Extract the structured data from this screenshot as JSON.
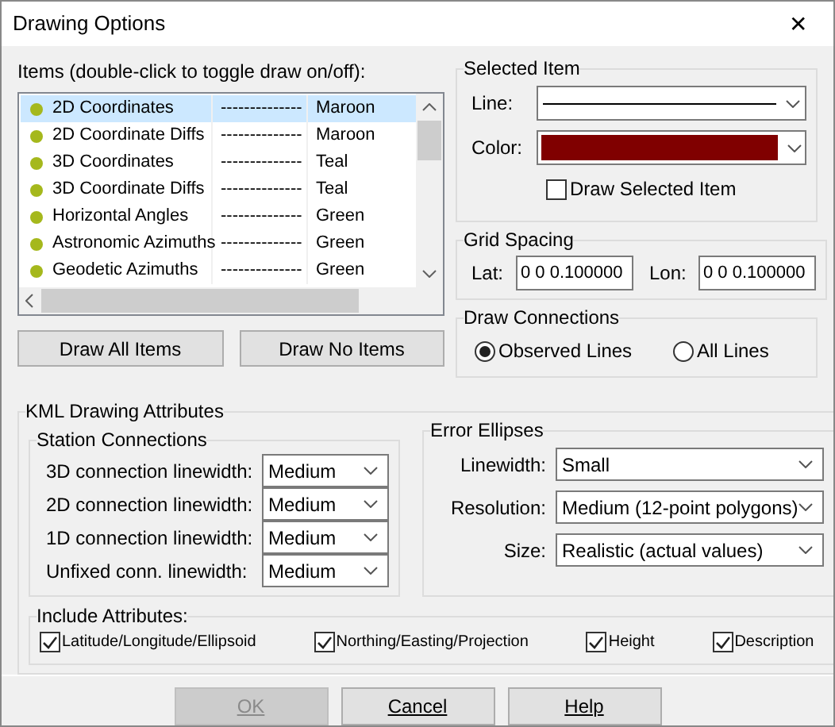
{
  "window": {
    "title": "Drawing Options",
    "close": "✕"
  },
  "items": {
    "label": "Items (double-click to toggle draw on/off):",
    "rows": [
      {
        "name": "2D Coordinates",
        "line": "--------------",
        "color_name": "Maroon",
        "selected": true,
        "color": "#a5b81c"
      },
      {
        "name": "2D Coordinate Diffs",
        "line": "--------------",
        "color_name": "Maroon",
        "selected": false,
        "color": "#a5b81c"
      },
      {
        "name": "3D Coordinates",
        "line": "--------------",
        "color_name": "Teal",
        "selected": false,
        "color": "#a5b81c"
      },
      {
        "name": "3D Coordinate Diffs",
        "line": "--------------",
        "color_name": "Teal",
        "selected": false,
        "color": "#a5b81c"
      },
      {
        "name": "Horizontal Angles",
        "line": "--------------",
        "color_name": "Green",
        "selected": false,
        "color": "#a5b81c"
      },
      {
        "name": "Astronomic Azimuths",
        "line": "--------------",
        "color_name": "Green",
        "selected": false,
        "color": "#a5b81c"
      },
      {
        "name": "Geodetic Azimuths",
        "line": "--------------",
        "color_name": "Green",
        "selected": false,
        "color": "#a5b81c"
      }
    ],
    "buttons": [
      "Draw All Items",
      "Draw No Items"
    ]
  },
  "selected_item": {
    "title": "Selected Item",
    "line_label": "Line:",
    "color_label": "Color:",
    "color": "#800000",
    "checkbox": {
      "label": "Draw Selected Item",
      "checked": false
    }
  },
  "grid_spacing": {
    "title": "Grid Spacing",
    "lat_label": "Lat:",
    "lat": "0 0 0.100000",
    "lon_label": "Lon:",
    "lon": "0 0 0.100000"
  },
  "draw_connections": {
    "title": "Draw Connections",
    "options": [
      {
        "label": "Observed Lines",
        "selected": true
      },
      {
        "label": "All Lines",
        "selected": false
      }
    ]
  },
  "kml": {
    "title": "KML Drawing Attributes",
    "station_connections": {
      "title": "Station Connections",
      "rows": [
        {
          "label": "3D connection linewidth:",
          "value": "Medium"
        },
        {
          "label": "2D connection linewidth:",
          "value": "Medium"
        },
        {
          "label": "1D connection linewidth:",
          "value": "Medium"
        },
        {
          "label": "Unfixed conn. linewidth:",
          "value": "Medium"
        }
      ]
    },
    "error_ellipses": {
      "title": "Error Ellipses",
      "rows": [
        {
          "label": "Linewidth:",
          "value": "Small"
        },
        {
          "label": "Resolution:",
          "value": "Medium (12-point polygons)"
        },
        {
          "label": "Size:",
          "value": "Realistic (actual values)"
        }
      ]
    },
    "include_attributes": {
      "title": "Include Attributes:",
      "options": [
        {
          "label": "Latitude/Longitude/Ellipsoid",
          "checked": true
        },
        {
          "label": "Northing/Easting/Projection",
          "checked": true
        },
        {
          "label": "Height",
          "checked": true
        },
        {
          "label": "Description",
          "checked": true
        }
      ]
    }
  },
  "buttons": [
    {
      "label": "OK",
      "disabled": true
    },
    {
      "label": "Cancel",
      "disabled": false
    },
    {
      "label": "Help",
      "disabled": false
    }
  ]
}
